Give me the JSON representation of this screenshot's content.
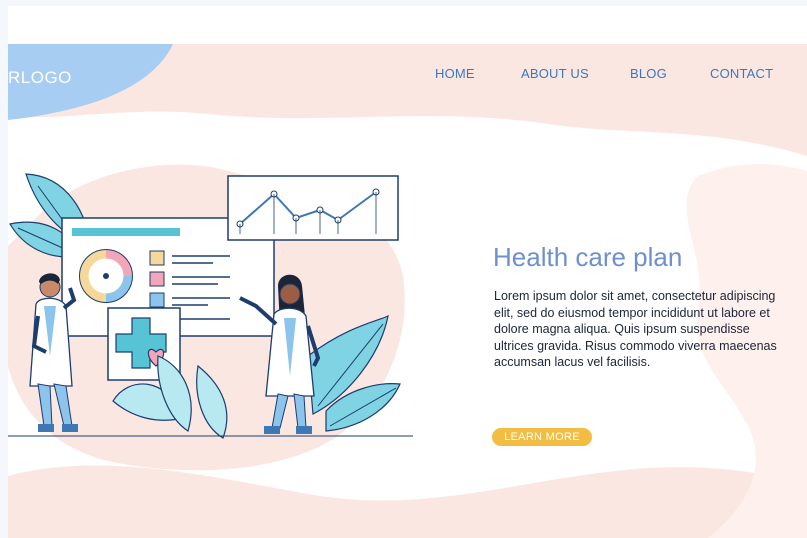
{
  "header": {
    "logo_text": "RLOGO",
    "nav": [
      {
        "label": "HOME"
      },
      {
        "label": "ABOUT US"
      },
      {
        "label": "BLOG"
      },
      {
        "label": "CONTACT"
      }
    ]
  },
  "hero": {
    "title": "Health care plan",
    "body": "Lorem ipsum dolor sit amet, consectetur adipiscing elit, sed do eiusmod tempor incididunt ut labore et dolore magna aliqua. Quis ipsum suspendisse ultrices gravida. Risus commodo viverra maecenas accumsan lacus vel facilisis.",
    "cta_label": "LEARN MORE"
  },
  "colors": {
    "accent_blue": "#3d78b5",
    "title_blue": "#6e8fd0",
    "cta_yellow": "#f3bd43",
    "blob_pink": "#fbe7e2",
    "logo_blob_blue": "#a8cdf2",
    "leaf_teal": "#7fd3e2"
  },
  "illustration": {
    "icons": [
      "medical-cross-icon",
      "heart-icon",
      "donut-chart-icon",
      "line-chart-icon"
    ]
  }
}
